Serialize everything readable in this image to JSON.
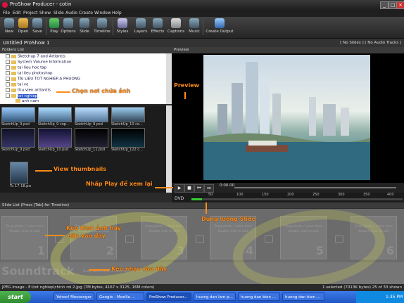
{
  "window": {
    "title": "ProShow Producer - cotin"
  },
  "menu": [
    "File",
    "Edit",
    "Project",
    "Show",
    "Slide",
    "Audio",
    "Create",
    "Window",
    "Help"
  ],
  "toolbar": {
    "new": "New",
    "open": "Open",
    "save": "Save",
    "play": "Play",
    "options": "Options",
    "slide": "Slide",
    "timeline": "Timeline",
    "styles": "Styles",
    "layers": "Layers",
    "effects": "Effects",
    "captions": "Captions",
    "music": "Music",
    "create_output": "Create Output"
  },
  "project": {
    "title": "Untitled ProShow 1",
    "status": "[ No Slides ]  [ No Audio Tracks ]"
  },
  "folders": {
    "header": "Folders List",
    "items": [
      "Sketchup 7 and Artlantis",
      "System Volume Information",
      "tai lieu hoc tap",
      "tai lieu photoshop",
      "TAI LIEU TOT NGHIEP-A PHUONG",
      "tai ve",
      "thu vien artlantis",
      "tot nghiep",
      "anh nam"
    ]
  },
  "thumbnails": [
    "SketchUp_9.psd",
    "SketchUp_9 cop...",
    "SketchUp_9.psd",
    "SketchUp_10 co...",
    "SketchUp_9.psd",
    "SketchUp_10.psd",
    "SketchUp_11.psd",
    "SketchUp_122 c...",
    "SketchUp_10.psd",
    "SketchUp_133.p...",
    "Tu 17-18.psd"
  ],
  "preview": {
    "header": "Preview",
    "time": "0:00.00"
  },
  "timeline_ticks": [
    "50",
    "100",
    "150",
    "200",
    "250",
    "300",
    "350",
    "400",
    "450"
  ],
  "output": {
    "label": "DVD",
    "usage": 0.05
  },
  "slides": {
    "header": "Slide List (Press [Tab] for Timeline)",
    "drop_line1": "Drag photo / video here",
    "drop_line2": "Double click to add",
    "slot_label": "Slide",
    "slots": [
      "1",
      "2",
      "3",
      "4",
      "5",
      "6"
    ]
  },
  "soundtrack": {
    "label": "Soundtrack",
    "hint": "Drop music here. Double click to edit."
  },
  "status": {
    "left": "JPEG Image - E:\\tot nghiep\\chinh roi 2.jpg (7M bytes, 4167 x 3125, 16M colors)",
    "right": "1 selected (7013K bytes) 25 of 33 shown"
  },
  "taskbar": {
    "start": "start",
    "tasks": [
      "Yahoo! Messenger",
      "Google - Mozilla ...",
      "ProShow Producer...",
      "huong dan lam p...",
      "huong dan bien ...",
      "huong dan bien ..."
    ],
    "clock": "1:35 PM"
  },
  "annotations": {
    "folder": "Chọn nơi chứa ảnh",
    "preview": "Preview",
    "thumbs": "View thumbnails",
    "play": "Nhấp Play để xem lại",
    "slide_size": "Dung lượng Slide",
    "drag_clip_1": "Kéo hình ảnh hay",
    "drag_clip_2": "clip  vào đây",
    "drag_music": "Kéo nhạc vào đây"
  },
  "colors": {
    "annotation": "#ff8c1a",
    "watermark": "#d7dc50",
    "selection": "#2b54c8"
  }
}
